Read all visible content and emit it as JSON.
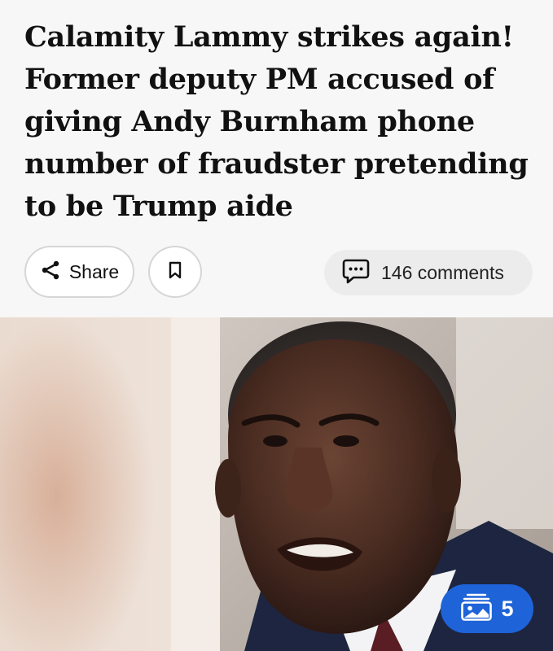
{
  "article": {
    "headline": "Calamity Lammy strikes again! Former deputy PM accused of giving Andy Burnham phone number of fraudster pretending to be Trump aide"
  },
  "actions": {
    "share_label": "Share",
    "comments_label": "146 comments"
  },
  "gallery": {
    "count": "5"
  },
  "icons": {
    "share": "share-icon",
    "bookmark": "bookmark-icon",
    "comments": "comment-bubble-icon",
    "gallery": "image-gallery-icon"
  },
  "colors": {
    "background": "#f7f7f7",
    "headline_text": "#111111",
    "button_border": "#d6d6d6",
    "comments_pill": "#ececec",
    "gallery_badge": "#1e63d8"
  }
}
